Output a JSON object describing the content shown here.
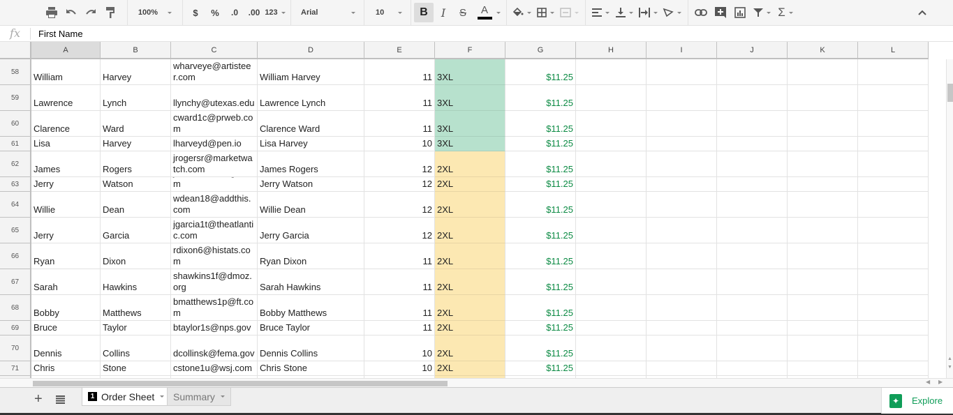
{
  "toolbar": {
    "zoom": "100%",
    "currency": "$",
    "percent": "%",
    "decrease_decimal": ".0",
    "increase_decimal": ".00",
    "more_formats": "123",
    "font": "Arial",
    "font_size": "10",
    "bold": "B",
    "italic": "I",
    "strike": "S",
    "text_color_label": "A",
    "text_color": "#000000"
  },
  "formula_bar": {
    "fx": "fx",
    "value": "First Name"
  },
  "columns": [
    "A",
    "B",
    "C",
    "D",
    "E",
    "F",
    "G",
    "H",
    "I",
    "J",
    "K",
    "L"
  ],
  "selected_column": "A",
  "rows": [
    {
      "n": "58",
      "a": "William",
      "b": "Harvey",
      "c": "wharveye@artisteer.com",
      "d": "William Harvey",
      "e": "11",
      "f": "3XL",
      "g": "$11.25",
      "tall": true
    },
    {
      "n": "59",
      "a": "Lawrence",
      "b": "Lynch",
      "c": "llynchy@utexas.edu",
      "d": "Lawrence Lynch",
      "e": "11",
      "f": "3XL",
      "g": "$11.25",
      "tall": true
    },
    {
      "n": "60",
      "a": "Clarence",
      "b": "Ward",
      "c": "cward1c@prweb.com",
      "d": "Clarence Ward",
      "e": "11",
      "f": "3XL",
      "g": "$11.25",
      "tall": true
    },
    {
      "n": "61",
      "a": "Lisa",
      "b": "Harvey",
      "c": "lharveyd@pen.io",
      "d": "Lisa Harvey",
      "e": "10",
      "f": "3XL",
      "g": "$11.25",
      "tall": false
    },
    {
      "n": "62",
      "a": "James",
      "b": "Rogers",
      "c": "jrogersr@marketwatch.com",
      "d": "James Rogers",
      "e": "12",
      "f": "2XL",
      "g": "$11.25",
      "tall": true
    },
    {
      "n": "63",
      "a": "Jerry",
      "b": "Watson",
      "c": "jwatsonu@ning.com",
      "d": "Jerry Watson",
      "e": "12",
      "f": "2XL",
      "g": "$11.25",
      "tall": false
    },
    {
      "n": "64",
      "a": "Willie",
      "b": "Dean",
      "c": "wdean18@addthis.com",
      "d": "Willie Dean",
      "e": "12",
      "f": "2XL",
      "g": "$11.25",
      "tall": true
    },
    {
      "n": "65",
      "a": "Jerry",
      "b": "Garcia",
      "c": "jgarcia1t@theatlantic.com",
      "d": "Jerry Garcia",
      "e": "12",
      "f": "2XL",
      "g": "$11.25",
      "tall": true
    },
    {
      "n": "66",
      "a": "Ryan",
      "b": "Dixon",
      "c": "rdixon6@histats.com",
      "d": "Ryan Dixon",
      "e": "11",
      "f": "2XL",
      "g": "$11.25",
      "tall": true
    },
    {
      "n": "67",
      "a": "Sarah",
      "b": "Hawkins",
      "c": "shawkins1f@dmoz.org",
      "d": "Sarah Hawkins",
      "e": "11",
      "f": "2XL",
      "g": "$11.25",
      "tall": true
    },
    {
      "n": "68",
      "a": "Bobby",
      "b": "Matthews",
      "c": "bmatthews1p@ft.com",
      "d": "Bobby Matthews",
      "e": "11",
      "f": "2XL",
      "g": "$11.25",
      "tall": true
    },
    {
      "n": "69",
      "a": "Bruce",
      "b": "Taylor",
      "c": "btaylor1s@nps.gov",
      "d": "Bruce Taylor",
      "e": "11",
      "f": "2XL",
      "g": "$11.25",
      "tall": false
    },
    {
      "n": "70",
      "a": "Dennis",
      "b": "Collins",
      "c": "dcollinsk@fema.gov",
      "d": "Dennis Collins",
      "e": "10",
      "f": "2XL",
      "g": "$11.25",
      "tall": true
    },
    {
      "n": "71",
      "a": "Chris",
      "b": "Stone",
      "c": "cstone1u@wsj.com",
      "d": "Chris Stone",
      "e": "10",
      "f": "2XL",
      "g": "$11.25",
      "tall": false
    }
  ],
  "size_colors": {
    "3XL": "#b7e1cd",
    "2XL": "#fce8b2"
  },
  "sheets": [
    {
      "label": "Order Sheet",
      "badge": "1",
      "active": true
    },
    {
      "label": "Summary",
      "active": false
    }
  ],
  "explore": {
    "label": "Explore"
  }
}
